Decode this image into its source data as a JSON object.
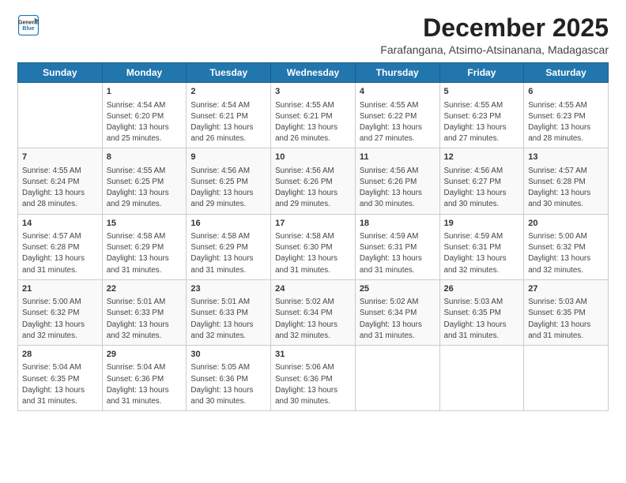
{
  "logo": {
    "line1": "General",
    "line2": "Blue"
  },
  "title": "December 2025",
  "subtitle": "Farafangana, Atsimo-Atsinanana, Madagascar",
  "header": {
    "accent_color": "#2176ae"
  },
  "days_of_week": [
    "Sunday",
    "Monday",
    "Tuesday",
    "Wednesday",
    "Thursday",
    "Friday",
    "Saturday"
  ],
  "weeks": [
    [
      {
        "day": "",
        "info": ""
      },
      {
        "day": "1",
        "info": "Sunrise: 4:54 AM\nSunset: 6:20 PM\nDaylight: 13 hours\nand 25 minutes."
      },
      {
        "day": "2",
        "info": "Sunrise: 4:54 AM\nSunset: 6:21 PM\nDaylight: 13 hours\nand 26 minutes."
      },
      {
        "day": "3",
        "info": "Sunrise: 4:55 AM\nSunset: 6:21 PM\nDaylight: 13 hours\nand 26 minutes."
      },
      {
        "day": "4",
        "info": "Sunrise: 4:55 AM\nSunset: 6:22 PM\nDaylight: 13 hours\nand 27 minutes."
      },
      {
        "day": "5",
        "info": "Sunrise: 4:55 AM\nSunset: 6:23 PM\nDaylight: 13 hours\nand 27 minutes."
      },
      {
        "day": "6",
        "info": "Sunrise: 4:55 AM\nSunset: 6:23 PM\nDaylight: 13 hours\nand 28 minutes."
      }
    ],
    [
      {
        "day": "7",
        "info": "Sunrise: 4:55 AM\nSunset: 6:24 PM\nDaylight: 13 hours\nand 28 minutes."
      },
      {
        "day": "8",
        "info": "Sunrise: 4:55 AM\nSunset: 6:25 PM\nDaylight: 13 hours\nand 29 minutes."
      },
      {
        "day": "9",
        "info": "Sunrise: 4:56 AM\nSunset: 6:25 PM\nDaylight: 13 hours\nand 29 minutes."
      },
      {
        "day": "10",
        "info": "Sunrise: 4:56 AM\nSunset: 6:26 PM\nDaylight: 13 hours\nand 29 minutes."
      },
      {
        "day": "11",
        "info": "Sunrise: 4:56 AM\nSunset: 6:26 PM\nDaylight: 13 hours\nand 30 minutes."
      },
      {
        "day": "12",
        "info": "Sunrise: 4:56 AM\nSunset: 6:27 PM\nDaylight: 13 hours\nand 30 minutes."
      },
      {
        "day": "13",
        "info": "Sunrise: 4:57 AM\nSunset: 6:28 PM\nDaylight: 13 hours\nand 30 minutes."
      }
    ],
    [
      {
        "day": "14",
        "info": "Sunrise: 4:57 AM\nSunset: 6:28 PM\nDaylight: 13 hours\nand 31 minutes."
      },
      {
        "day": "15",
        "info": "Sunrise: 4:58 AM\nSunset: 6:29 PM\nDaylight: 13 hours\nand 31 minutes."
      },
      {
        "day": "16",
        "info": "Sunrise: 4:58 AM\nSunset: 6:29 PM\nDaylight: 13 hours\nand 31 minutes."
      },
      {
        "day": "17",
        "info": "Sunrise: 4:58 AM\nSunset: 6:30 PM\nDaylight: 13 hours\nand 31 minutes."
      },
      {
        "day": "18",
        "info": "Sunrise: 4:59 AM\nSunset: 6:31 PM\nDaylight: 13 hours\nand 31 minutes."
      },
      {
        "day": "19",
        "info": "Sunrise: 4:59 AM\nSunset: 6:31 PM\nDaylight: 13 hours\nand 32 minutes."
      },
      {
        "day": "20",
        "info": "Sunrise: 5:00 AM\nSunset: 6:32 PM\nDaylight: 13 hours\nand 32 minutes."
      }
    ],
    [
      {
        "day": "21",
        "info": "Sunrise: 5:00 AM\nSunset: 6:32 PM\nDaylight: 13 hours\nand 32 minutes."
      },
      {
        "day": "22",
        "info": "Sunrise: 5:01 AM\nSunset: 6:33 PM\nDaylight: 13 hours\nand 32 minutes."
      },
      {
        "day": "23",
        "info": "Sunrise: 5:01 AM\nSunset: 6:33 PM\nDaylight: 13 hours\nand 32 minutes."
      },
      {
        "day": "24",
        "info": "Sunrise: 5:02 AM\nSunset: 6:34 PM\nDaylight: 13 hours\nand 32 minutes."
      },
      {
        "day": "25",
        "info": "Sunrise: 5:02 AM\nSunset: 6:34 PM\nDaylight: 13 hours\nand 31 minutes."
      },
      {
        "day": "26",
        "info": "Sunrise: 5:03 AM\nSunset: 6:35 PM\nDaylight: 13 hours\nand 31 minutes."
      },
      {
        "day": "27",
        "info": "Sunrise: 5:03 AM\nSunset: 6:35 PM\nDaylight: 13 hours\nand 31 minutes."
      }
    ],
    [
      {
        "day": "28",
        "info": "Sunrise: 5:04 AM\nSunset: 6:35 PM\nDaylight: 13 hours\nand 31 minutes."
      },
      {
        "day": "29",
        "info": "Sunrise: 5:04 AM\nSunset: 6:36 PM\nDaylight: 13 hours\nand 31 minutes."
      },
      {
        "day": "30",
        "info": "Sunrise: 5:05 AM\nSunset: 6:36 PM\nDaylight: 13 hours\nand 30 minutes."
      },
      {
        "day": "31",
        "info": "Sunrise: 5:06 AM\nSunset: 6:36 PM\nDaylight: 13 hours\nand 30 minutes."
      },
      {
        "day": "",
        "info": ""
      },
      {
        "day": "",
        "info": ""
      },
      {
        "day": "",
        "info": ""
      }
    ]
  ]
}
